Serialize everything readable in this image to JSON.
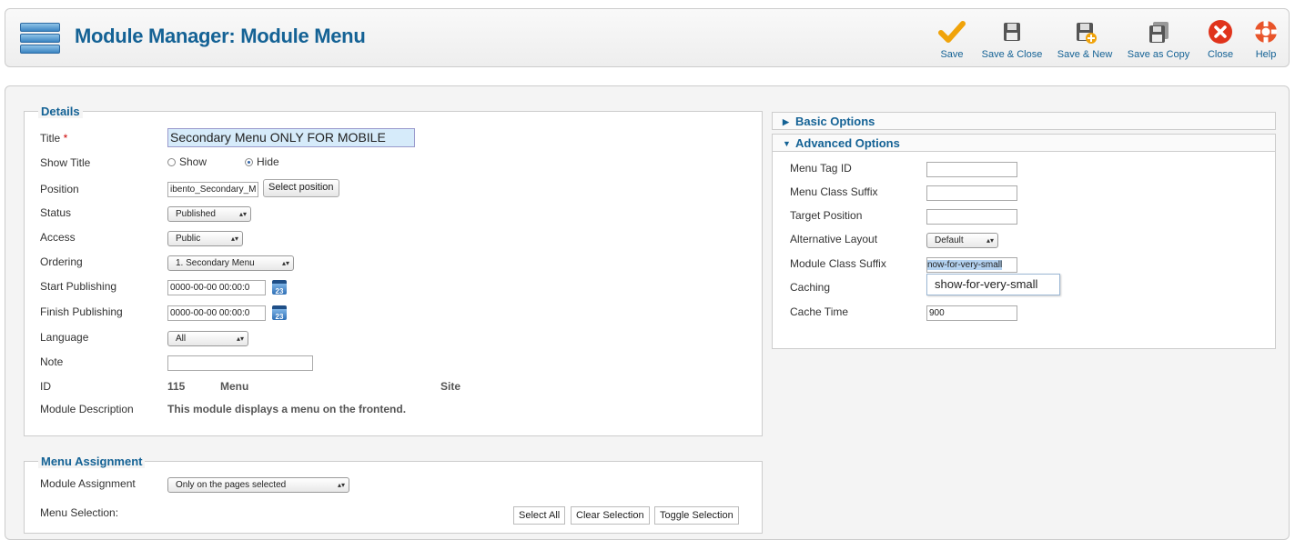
{
  "header": {
    "title": "Module Manager: Module Menu",
    "buttons": {
      "save": "Save",
      "save_close": "Save & Close",
      "save_new": "Save & New",
      "save_copy": "Save as Copy",
      "close": "Close",
      "help": "Help"
    }
  },
  "details": {
    "legend": "Details",
    "title_label": "Title",
    "title_required": "*",
    "title_value": "Secondary Menu ONLY FOR MOBILE",
    "show_title_label": "Show Title",
    "show_option": "Show",
    "hide_option": "Hide",
    "show_title_selected": "Hide",
    "position_label": "Position",
    "position_value": "ibento_Secondary_M",
    "select_position_button": "Select position",
    "status_label": "Status",
    "status_value": "Published",
    "access_label": "Access",
    "access_value": "Public",
    "ordering_label": "Ordering",
    "ordering_value": "1. Secondary Menu",
    "start_publishing_label": "Start Publishing",
    "start_publishing_value": "0000-00-00 00:00:0",
    "finish_publishing_label": "Finish Publishing",
    "finish_publishing_value": "0000-00-00 00:00:0",
    "calendar_day": "23",
    "language_label": "Language",
    "language_value": "All",
    "note_label": "Note",
    "note_value": "",
    "id_label": "ID",
    "id_value": "115",
    "module_type": "Menu",
    "client": "Site",
    "description_label": "Module Description",
    "description_value": "This module displays a menu on the frontend."
  },
  "menu_assignment": {
    "legend": "Menu Assignment",
    "module_assignment_label": "Module Assignment",
    "module_assignment_value": "Only on the pages selected",
    "menu_selection_label": "Menu Selection:",
    "select_all": "Select All",
    "clear_selection": "Clear Selection",
    "toggle_selection": "Toggle Selection"
  },
  "options": {
    "basic_title": "Basic Options",
    "advanced_title": "Advanced Options",
    "menu_tag_id_label": "Menu Tag ID",
    "menu_tag_id_value": "",
    "menu_class_suffix_label": "Menu Class Suffix",
    "menu_class_suffix_value": "",
    "target_position_label": "Target Position",
    "target_position_value": "",
    "alternative_layout_label": "Alternative Layout",
    "alternative_layout_value": "Default",
    "module_class_suffix_label": "Module Class Suffix",
    "module_class_suffix_value": "now-for-very-small",
    "autocomplete_suggestion": "show-for-very-small",
    "caching_label": "Caching",
    "cache_time_label": "Cache Time",
    "cache_time_value": "900"
  },
  "colors": {
    "accent": "#146295",
    "save_check": "#f0a30a",
    "close_red": "#e0331b"
  }
}
